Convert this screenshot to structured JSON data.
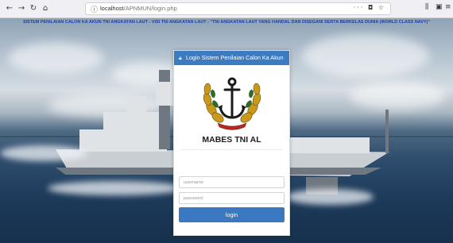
{
  "browser": {
    "url_host": "localhost",
    "url_path": "/APNMUN/login.php",
    "page_actions_icon": "ellipsis-icon",
    "bookmark_icon": "star-icon"
  },
  "page": {
    "marquee_text": "SISTEM PENILAIAN CALON KA AKUN TNI ANGKATAN LAUT - VISI TNI ANGKATAN LAUT : \"TNI ANGKATAN LAUT YANG HANDAL DAN DISEGANI SERTA BERKELAS DUNIA (WORLD CLASS NAVY)\""
  },
  "login": {
    "header_title": "Login Sistem Penilaian Calon Ka Akun",
    "brand": "MABES TNI AL",
    "username_placeholder": "username",
    "password_placeholder": "password",
    "button_label": "login"
  },
  "colors": {
    "accent": "#3a78c2",
    "marquee_text": "#1a3fb0"
  }
}
